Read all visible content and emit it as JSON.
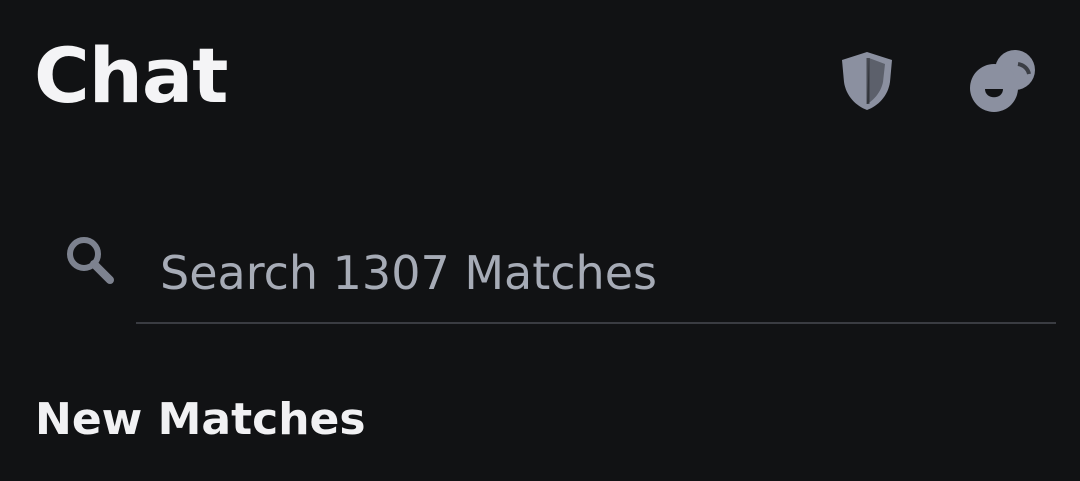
{
  "header": {
    "title": "Chat",
    "icons": {
      "shield": "shield-icon",
      "chat": "chat-bubbles-icon"
    },
    "icon_color": "#8b90a0"
  },
  "search": {
    "placeholder": "Search 1307 Matches",
    "icon": "search-icon",
    "icon_color": "#7d828f"
  },
  "sections": {
    "new_matches_title": "New Matches"
  },
  "colors": {
    "background": "#111214",
    "text_primary": "#f4f4f6",
    "text_secondary": "#a6abb6",
    "divider": "#3a3c42"
  }
}
